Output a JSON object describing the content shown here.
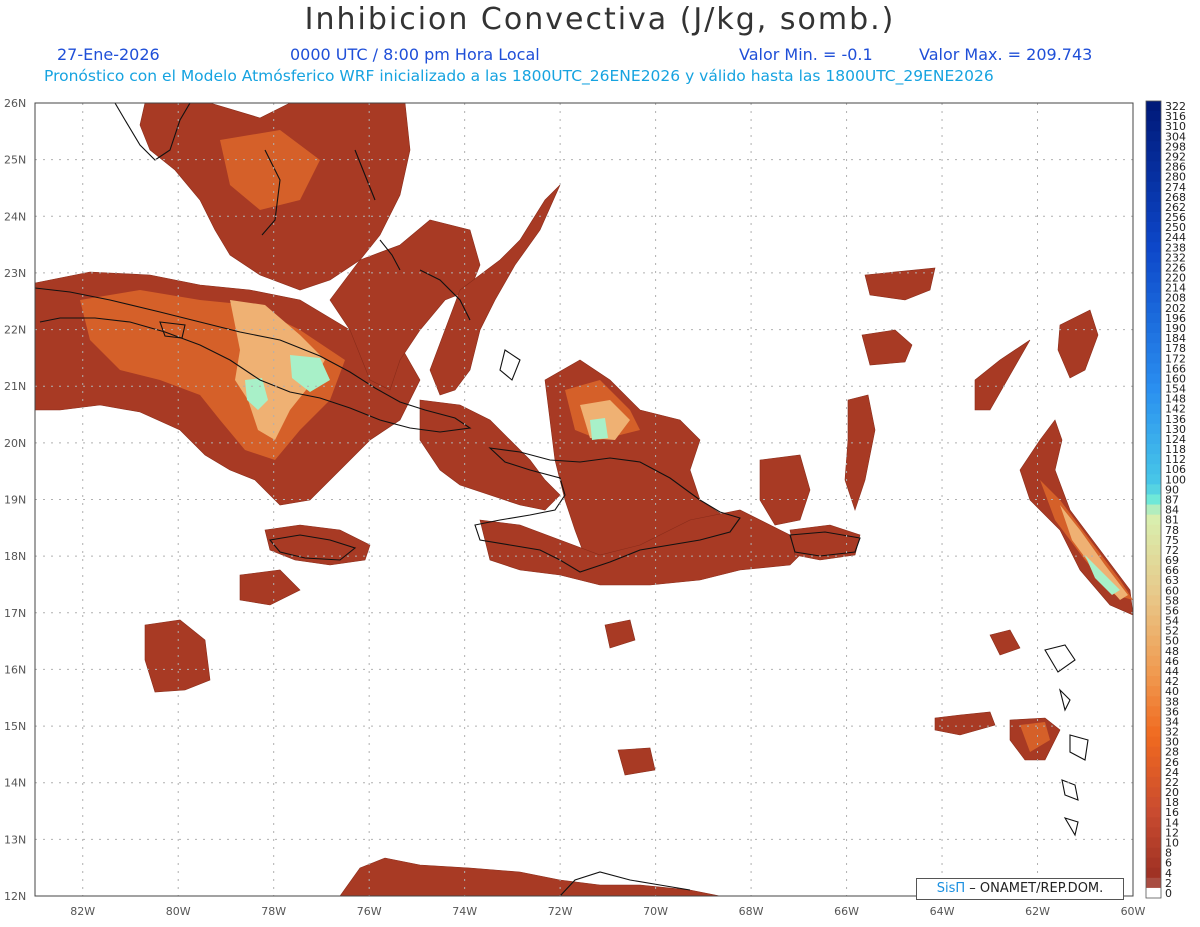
{
  "header": {
    "title": "Inhibicion Convectiva (J/kg, somb.)",
    "date": "27-Ene-2026",
    "time": "0000 UTC / 8:00 pm Hora Local",
    "min_label": "Valor Min. = -0.1",
    "max_label": "Valor Max. = 209.743",
    "subtitle": "Pronóstico con el Modelo Atmósferico WRF inicializado a las 1800UTC_26ENE2026 y válido hasta las  1800UTC_29ENE2026"
  },
  "map": {
    "lon_range": [
      -83,
      -60
    ],
    "lat_range": [
      12,
      26
    ],
    "lon_ticks": [
      "82W",
      "80W",
      "78W",
      "76W",
      "74W",
      "72W",
      "70W",
      "68W",
      "66W",
      "64W",
      "62W",
      "60W"
    ],
    "lat_ticks": [
      "26N",
      "25N",
      "24N",
      "23N",
      "22N",
      "21N",
      "20N",
      "19N",
      "18N",
      "17N",
      "16N",
      "15N",
      "14N",
      "13N",
      "12N"
    ],
    "colors": {
      "low": "#a83a24",
      "mid": "#d9652a",
      "high": "#efb173",
      "peak": "#a8f0c8",
      "coast": "#111111",
      "grid": "#b0b0b0"
    }
  },
  "colorbar": {
    "labels": [
      "322",
      "316",
      "310",
      "304",
      "298",
      "292",
      "286",
      "280",
      "274",
      "268",
      "262",
      "256",
      "250",
      "244",
      "238",
      "232",
      "226",
      "220",
      "214",
      "208",
      "202",
      "196",
      "190",
      "184",
      "178",
      "172",
      "166",
      "160",
      "154",
      "148",
      "142",
      "136",
      "130",
      "124",
      "118",
      "112",
      "106",
      "100",
      "90",
      "87",
      "84",
      "81",
      "78",
      "75",
      "72",
      "69",
      "66",
      "63",
      "60",
      "58",
      "56",
      "54",
      "52",
      "50",
      "48",
      "46",
      "44",
      "42",
      "40",
      "38",
      "36",
      "34",
      "32",
      "30",
      "28",
      "26",
      "24",
      "22",
      "20",
      "18",
      "16",
      "14",
      "12",
      "10",
      "8",
      "6",
      "4",
      "2",
      "0"
    ]
  },
  "credit": {
    "brand": "SisΠ",
    "text": " – ONAMET/REP.DOM."
  }
}
